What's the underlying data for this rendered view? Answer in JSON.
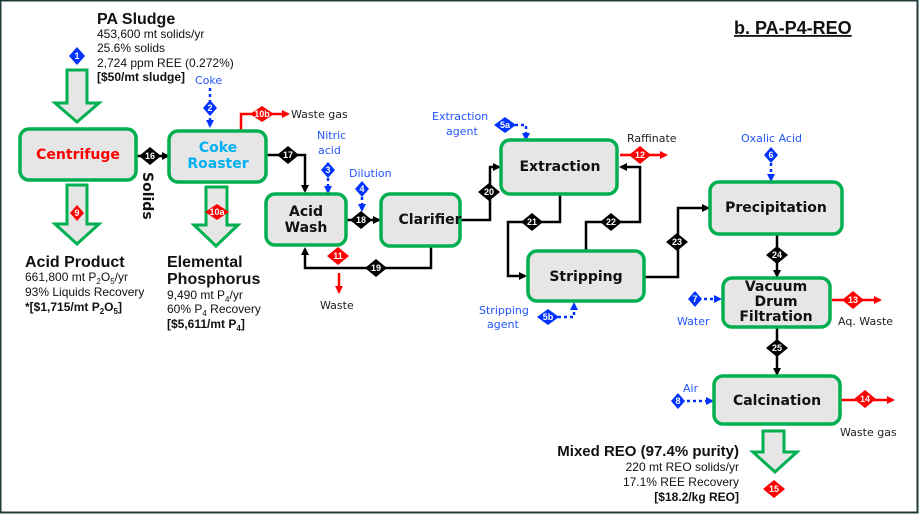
{
  "title": "b. PA-P4-REO",
  "colors": {
    "box_border": "#00b050",
    "box_fill": "#e6e6e6",
    "waste": "#ff0000",
    "input": "#0033ff",
    "internal": "#000000",
    "coke_roaster_text": "#00b0f0",
    "centrifuge_text": "#ff0000"
  },
  "feed": {
    "title": "PA Sludge",
    "lines": [
      "453,600 mt solids/yr",
      "25.6% solids",
      "2,724 ppm REE (0.272%)"
    ],
    "price": "[$50/mt sludge]"
  },
  "units": {
    "centrifuge": "Centrifuge",
    "coke_roaster": [
      "Coke",
      "Roaster"
    ],
    "acid_wash": [
      "Acid",
      "Wash"
    ],
    "clarifier": "Clarifier",
    "extraction": "Extraction",
    "stripping": "Stripping",
    "precipitation": "Precipitation",
    "vacuum_drum_filtration": [
      "Vacuum",
      "Drum",
      "Filtration"
    ],
    "calcination": "Calcination"
  },
  "labels": {
    "solids": "Solids",
    "coke": "Coke",
    "waste_gas_1": "Waste gas",
    "nitric_acid": [
      "Nitric",
      "acid"
    ],
    "dilution": "Dilution",
    "waste": "Waste",
    "extraction_agent": [
      "Extraction",
      "agent"
    ],
    "raffinate": "Raffinate",
    "stripping_agent": [
      "Stripping",
      "agent"
    ],
    "oxalic_acid": "Oxalic Acid",
    "water": "Water",
    "aq_waste": "Aq. Waste",
    "air": "Air",
    "waste_gas_2": "Waste gas"
  },
  "streams": {
    "s1": "1",
    "s2": "2",
    "s3": "3",
    "s4": "4",
    "s5a": "5a",
    "s5b": "5b",
    "s6": "6",
    "s7": "7",
    "s8": "8",
    "s9": "9",
    "s10a": "10a",
    "s10b": "10b",
    "s11": "11",
    "s12": "12",
    "s13": "13",
    "s14": "14",
    "s15": "15",
    "s16": "16",
    "s17": "17",
    "s18": "18",
    "s19": "19",
    "s20": "20",
    "s21": "21",
    "s22": "22",
    "s23": "23",
    "s24": "24",
    "s25": "25"
  },
  "products": {
    "acid": {
      "title": "Acid Product",
      "line1": [
        "661,800 mt P",
        "2",
        "O",
        "5",
        "/yr"
      ],
      "line2": "93% Liquids Recovery",
      "price": [
        "*[$1,715/mt P",
        "2",
        "O",
        "5",
        "]"
      ]
    },
    "phosphorus": {
      "title": [
        "Elemental",
        "Phosphorus"
      ],
      "line1": [
        "9,490 mt P",
        "4",
        "/yr"
      ],
      "line2": [
        "60% P",
        "4",
        " Recovery"
      ],
      "price": [
        "[$5,611/mt P",
        "4",
        "]"
      ]
    },
    "reo": {
      "title": "Mixed REO (97.4% purity)",
      "lines": [
        "220 mt REO solids/yr",
        "17.1% REE Recovery"
      ],
      "price": "[$18.2/kg REO]"
    }
  }
}
